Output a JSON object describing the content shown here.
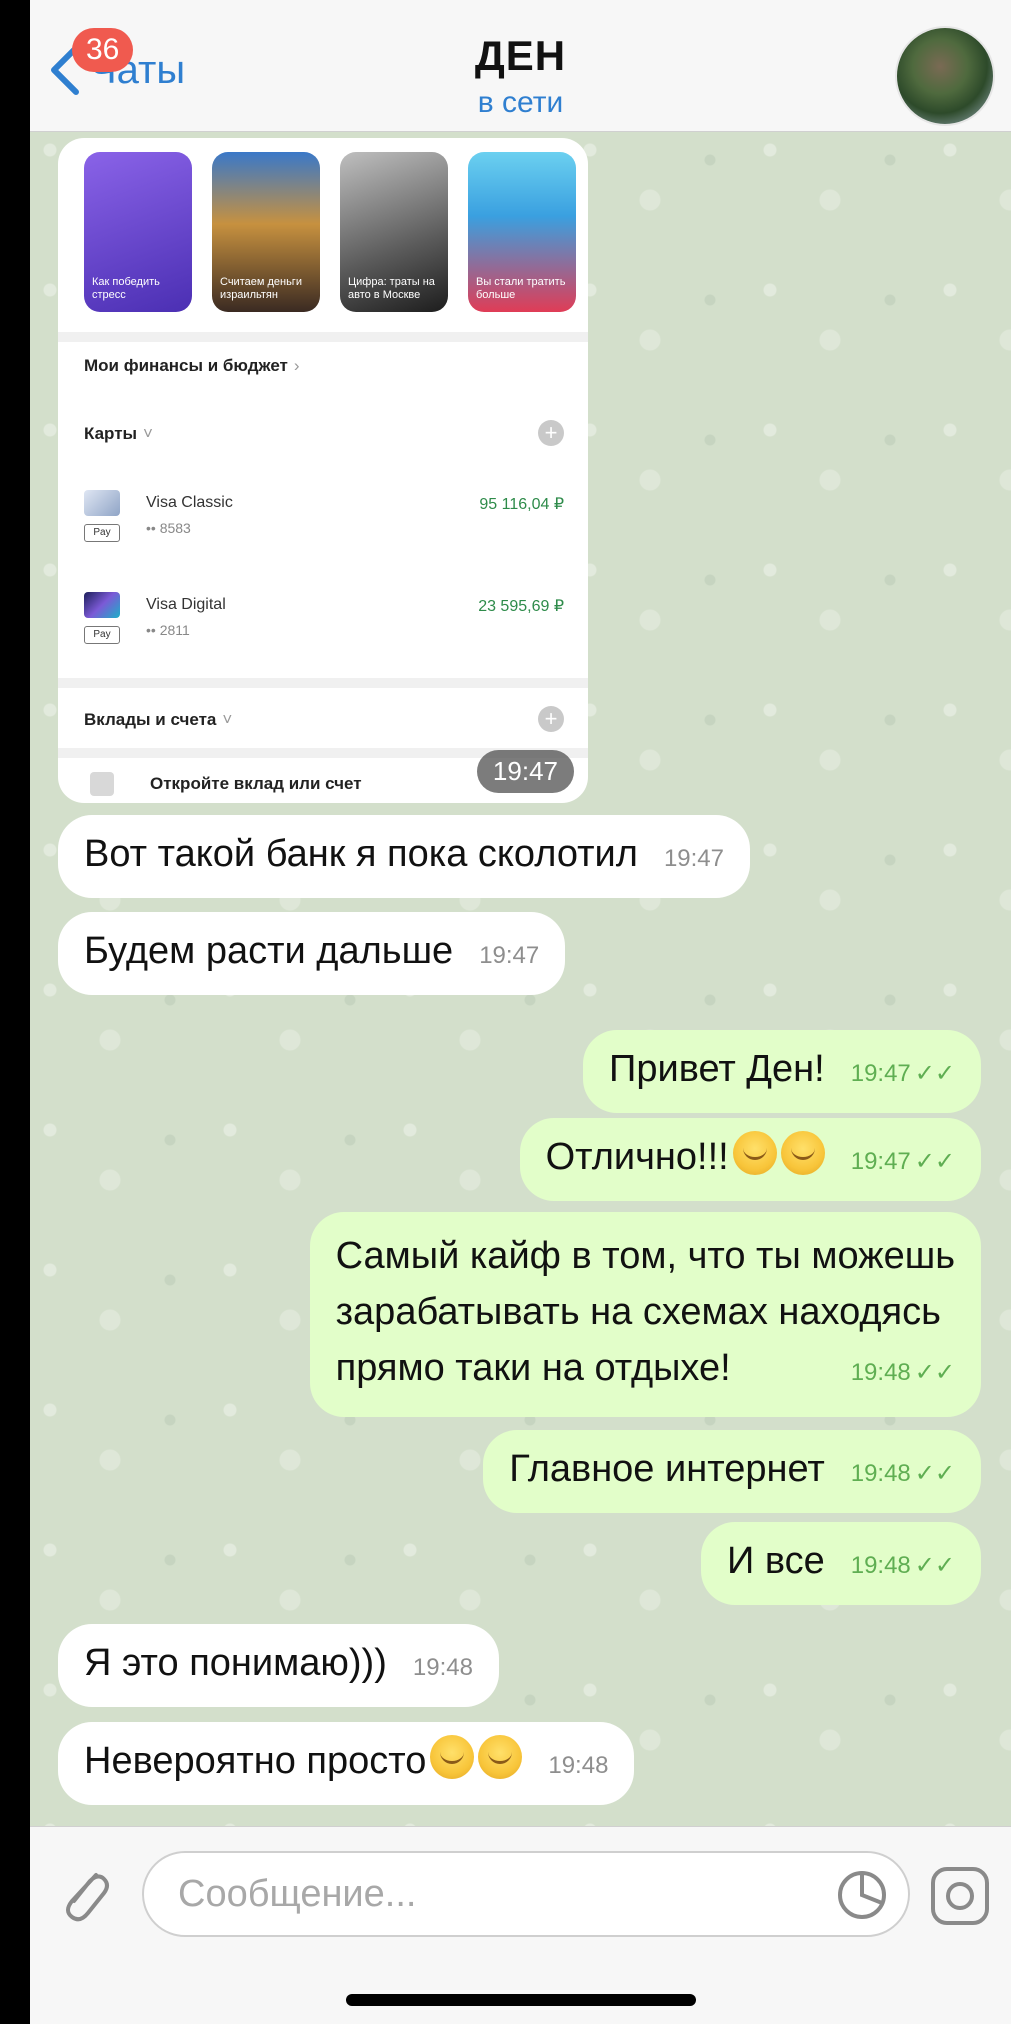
{
  "header": {
    "back_label": "Чаты",
    "unread_badge": "36",
    "title": "ДЕН",
    "status": "в сети"
  },
  "bank_screenshot": {
    "stories": [
      "Как победить стресс",
      "Считаем деньги израильтян",
      "Цифра: траты на авто в Москве",
      "Вы стали тратить больше"
    ],
    "finance_section": "Мои финансы и бюджет",
    "cards_section": "Карты",
    "cards": [
      {
        "name": "Visa Classic",
        "number": "•• 8583",
        "amount": "95 116,04 ₽",
        "pay": "Pay"
      },
      {
        "name": "Visa Digital",
        "number": "•• 2811",
        "amount": "23 595,69 ₽",
        "pay": "Pay"
      }
    ],
    "deposits_section": "Вклады и счета",
    "deposit_cta": "Откройте вклад или счет",
    "time": "19:47"
  },
  "messages": [
    {
      "side": "in",
      "text": "Вот такой банк я пока сколотил",
      "time": "19:47"
    },
    {
      "side": "in",
      "text": "Будем расти дальше",
      "time": "19:47"
    },
    {
      "side": "out",
      "text": "Привет Ден!",
      "time": "19:47"
    },
    {
      "side": "out",
      "text": "Отлично!!!",
      "time": "19:47"
    },
    {
      "side": "out",
      "line1": "Самый кайф в том, что ты можешь",
      "line2": "зарабатывать на схемах находясь",
      "line3": "прямо таки на отдыхе!",
      "time": "19:48"
    },
    {
      "side": "out",
      "text": "Главное интернет",
      "time": "19:48"
    },
    {
      "side": "out",
      "text": "И все",
      "time": "19:48"
    },
    {
      "side": "in",
      "text": "Я это понимаю)))",
      "time": "19:48"
    },
    {
      "side": "in",
      "text": "Невероятно просто",
      "time": "19:48"
    }
  ],
  "input": {
    "placeholder": "Сообщение..."
  },
  "colors": {
    "accent": "#2f7fd0",
    "badge": "#f05a4f",
    "outgoing_bubble": "#e2fec9",
    "incoming_bubble": "#ffffff",
    "amount_green": "#2e8b4a"
  },
  "icons": {
    "back": "chevron-left-icon",
    "attach": "paperclip-icon",
    "sticker": "sticker-icon",
    "camera": "camera-icon",
    "read": "double-check-icon"
  }
}
